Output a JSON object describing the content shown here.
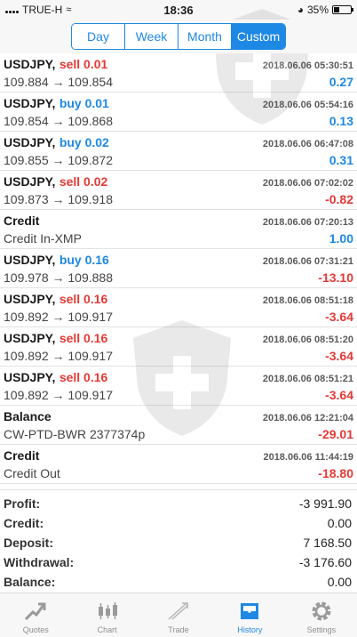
{
  "status_bar": {
    "carrier": "TRUE-H",
    "time": "18:36",
    "battery": "35%"
  },
  "period_tabs": [
    {
      "label": "Day",
      "active": false
    },
    {
      "label": "Week",
      "active": false
    },
    {
      "label": "Month",
      "active": false
    },
    {
      "label": "Custom",
      "active": true
    }
  ],
  "deals": [
    {
      "symbol": "USDJPY,",
      "action": "sell 0.01",
      "kind": "sell",
      "time": "2018.06.06 05:30:51",
      "detail": "109.884 → 109.854",
      "profit": "0.27",
      "sign": "pos"
    },
    {
      "symbol": "USDJPY,",
      "action": "buy 0.01",
      "kind": "buy",
      "time": "2018.06.06 05:54:16",
      "detail": "109.854 → 109.868",
      "profit": "0.13",
      "sign": "pos"
    },
    {
      "symbol": "USDJPY,",
      "action": "buy 0.02",
      "kind": "buy",
      "time": "2018.06.06 06:47:08",
      "detail": "109.855 → 109.872",
      "profit": "0.31",
      "sign": "pos"
    },
    {
      "symbol": "USDJPY,",
      "action": "sell 0.02",
      "kind": "sell",
      "time": "2018.06.06 07:02:02",
      "detail": "109.873 → 109.918",
      "profit": "-0.82",
      "sign": "neg"
    },
    {
      "symbol": "Credit",
      "action": "",
      "kind": "none",
      "time": "2018.06.06 07:20:13",
      "detail": "Credit In-XMP",
      "profit": "1.00",
      "sign": "pos"
    },
    {
      "symbol": "USDJPY,",
      "action": "buy 0.16",
      "kind": "buy",
      "time": "2018.06.06 07:31:21",
      "detail": "109.978 → 109.888",
      "profit": "-13.10",
      "sign": "neg"
    },
    {
      "symbol": "USDJPY,",
      "action": "sell 0.16",
      "kind": "sell",
      "time": "2018.06.06 08:51:18",
      "detail": "109.892 → 109.917",
      "profit": "-3.64",
      "sign": "neg"
    },
    {
      "symbol": "USDJPY,",
      "action": "sell 0.16",
      "kind": "sell",
      "time": "2018.06.06 08:51:20",
      "detail": "109.892 → 109.917",
      "profit": "-3.64",
      "sign": "neg"
    },
    {
      "symbol": "USDJPY,",
      "action": "sell 0.16",
      "kind": "sell",
      "time": "2018.06.06 08:51:21",
      "detail": "109.892 → 109.917",
      "profit": "-3.64",
      "sign": "neg"
    },
    {
      "symbol": "Balance",
      "action": "",
      "kind": "none",
      "time": "2018.06.06 12:21:04",
      "detail": "CW-PTD-BWR 2377374p",
      "profit": "-29.01",
      "sign": "neg"
    },
    {
      "symbol": "Credit",
      "action": "",
      "kind": "none",
      "time": "2018.06.06 11:44:19",
      "detail": "Credit Out",
      "profit": "-18.80",
      "sign": "neg"
    }
  ],
  "summary": [
    {
      "label": "Profit:",
      "value": "-3 991.90"
    },
    {
      "label": "Credit:",
      "value": "0.00"
    },
    {
      "label": "Deposit:",
      "value": "7 168.50"
    },
    {
      "label": "Withdrawal:",
      "value": "-3 176.60"
    },
    {
      "label": "Balance:",
      "value": "0.00"
    }
  ],
  "tabs": [
    {
      "label": "Quotes",
      "icon": "quotes-icon",
      "active": false
    },
    {
      "label": "Chart",
      "icon": "chart-icon",
      "active": false
    },
    {
      "label": "Trade",
      "icon": "trade-icon",
      "active": false
    },
    {
      "label": "History",
      "icon": "history-icon",
      "active": true
    },
    {
      "label": "Settings",
      "icon": "settings-icon",
      "active": false
    }
  ],
  "colors": {
    "accent": "#1e88e5",
    "loss": "#e53935",
    "gain": "#1e88e5"
  }
}
